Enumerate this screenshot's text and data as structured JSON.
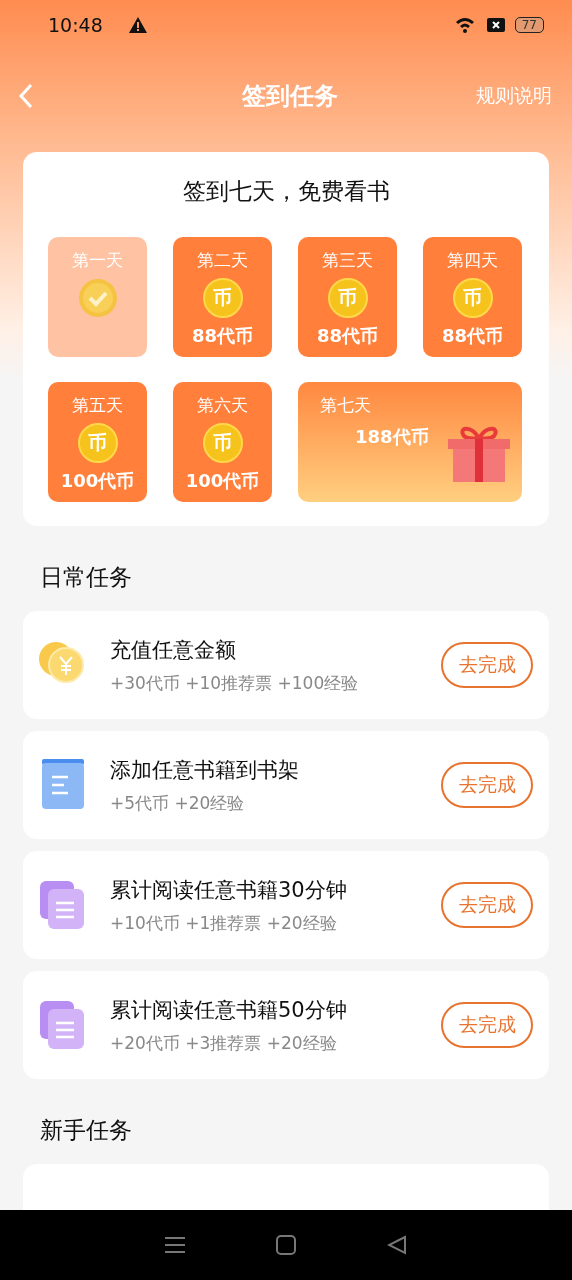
{
  "status_bar": {
    "time": "10:48",
    "battery": "77"
  },
  "header": {
    "title": "签到任务",
    "rules_link": "规则说明"
  },
  "checkin": {
    "title": "签到七天，免费看书",
    "days": [
      {
        "label": "第一天",
        "signed": true,
        "kind": "day"
      },
      {
        "label": "第二天",
        "coin": "币",
        "reward": "88代币",
        "signed": false,
        "kind": "day"
      },
      {
        "label": "第三天",
        "coin": "币",
        "reward": "88代币",
        "signed": false,
        "kind": "day"
      },
      {
        "label": "第四天",
        "coin": "币",
        "reward": "88代币",
        "signed": false,
        "kind": "day"
      },
      {
        "label": "第五天",
        "coin": "币",
        "reward": "100代币",
        "signed": false,
        "kind": "day"
      },
      {
        "label": "第六天",
        "coin": "币",
        "reward": "100代币",
        "signed": false,
        "kind": "day"
      },
      {
        "label": "第七天",
        "reward": "188代币",
        "signed": false,
        "kind": "bonus"
      }
    ]
  },
  "daily_tasks": {
    "title": "日常任务",
    "tasks": [
      {
        "kind": "coin",
        "name": "充值任意金额",
        "rewards": "+30代币 +10推荐票 +100经验",
        "button": "去完成"
      },
      {
        "kind": "book",
        "name": "添加任意书籍到书架",
        "rewards": "+5代币 +20经验",
        "button": "去完成"
      },
      {
        "kind": "docs",
        "name": "累计阅读任意书籍30分钟",
        "rewards": "+10代币 +1推荐票 +20经验",
        "button": "去完成"
      },
      {
        "kind": "docs",
        "name": "累计阅读任意书籍50分钟",
        "rewards": "+20代币 +3推荐票 +20经验",
        "button": "去完成"
      }
    ]
  },
  "newbie_tasks": {
    "title": "新手任务"
  }
}
